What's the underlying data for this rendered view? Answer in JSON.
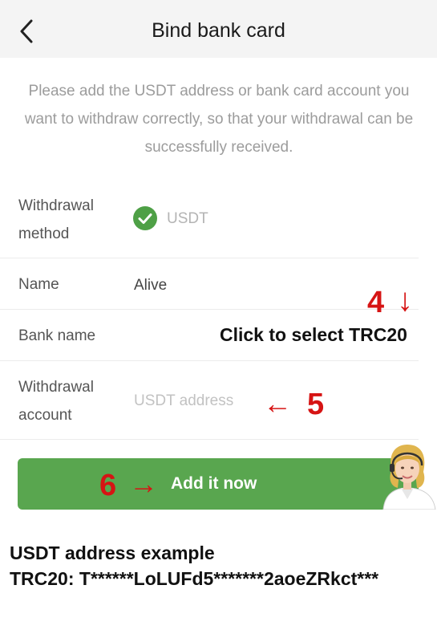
{
  "header": {
    "title": "Bind bank card"
  },
  "notice": "Please add the USDT address or bank card account you want to withdraw correctly, so that your withdrawal can be successfully received.",
  "form": {
    "method_label_line1": "Withdrawal",
    "method_label_line2": "method",
    "method_value": "USDT",
    "name_label": "Name",
    "name_value": "Alive",
    "bank_label": "Bank name",
    "account_label_line1": "Withdrawal",
    "account_label_line2": "account",
    "account_placeholder": "USDT address"
  },
  "annotations": {
    "step4": "4",
    "step4_arrow": "↓",
    "select_hint": "Click to select TRC20",
    "step5_arrow": "←",
    "step5": "5",
    "step6": "6",
    "step6_arrow": "→"
  },
  "button": {
    "label": "Add it now"
  },
  "example": {
    "title": "USDT address example",
    "value": "TRC20: T******LoLUFd5*******2aoeZRkct***"
  },
  "colors": {
    "accent": "#59a64f",
    "check": "#4ea046",
    "annotation": "#d61414"
  },
  "icons": {
    "back": "chevron-left-icon",
    "check": "check-circle-icon",
    "agent": "support-agent-icon"
  }
}
